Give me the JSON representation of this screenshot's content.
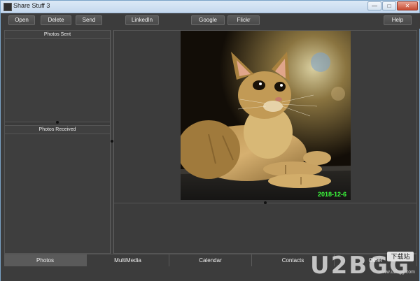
{
  "window": {
    "title": "Share Stuff 3",
    "controls": [
      "minimize-icon",
      "maximize-icon",
      "close-icon"
    ]
  },
  "toolbar": {
    "open_label": "Open",
    "delete_label": "Delete",
    "send_label": "Send",
    "linkedin_label": "LinkedIn",
    "google_label": "Google",
    "flickr_label": "Flickr",
    "help_label": "Help"
  },
  "left": {
    "sent_header": "Photos Sent",
    "received_header": "Photos Received"
  },
  "preview": {
    "date_stamp": "2018-12-6",
    "date_color": "#3cff3c"
  },
  "tabs": [
    {
      "label": "Photos",
      "active": true
    },
    {
      "label": "MultiMedia",
      "active": false
    },
    {
      "label": "Calendar",
      "active": false
    },
    {
      "label": "Contacts",
      "active": false
    },
    {
      "label": "Other",
      "active": false
    }
  ],
  "watermark": {
    "logo_text": "U2BGG",
    "stamp_text": "下载站",
    "small_text": "www.u2bgg.com"
  },
  "colors": {
    "background": "#3c3c3c",
    "active_tab": "#5a5a5a"
  }
}
